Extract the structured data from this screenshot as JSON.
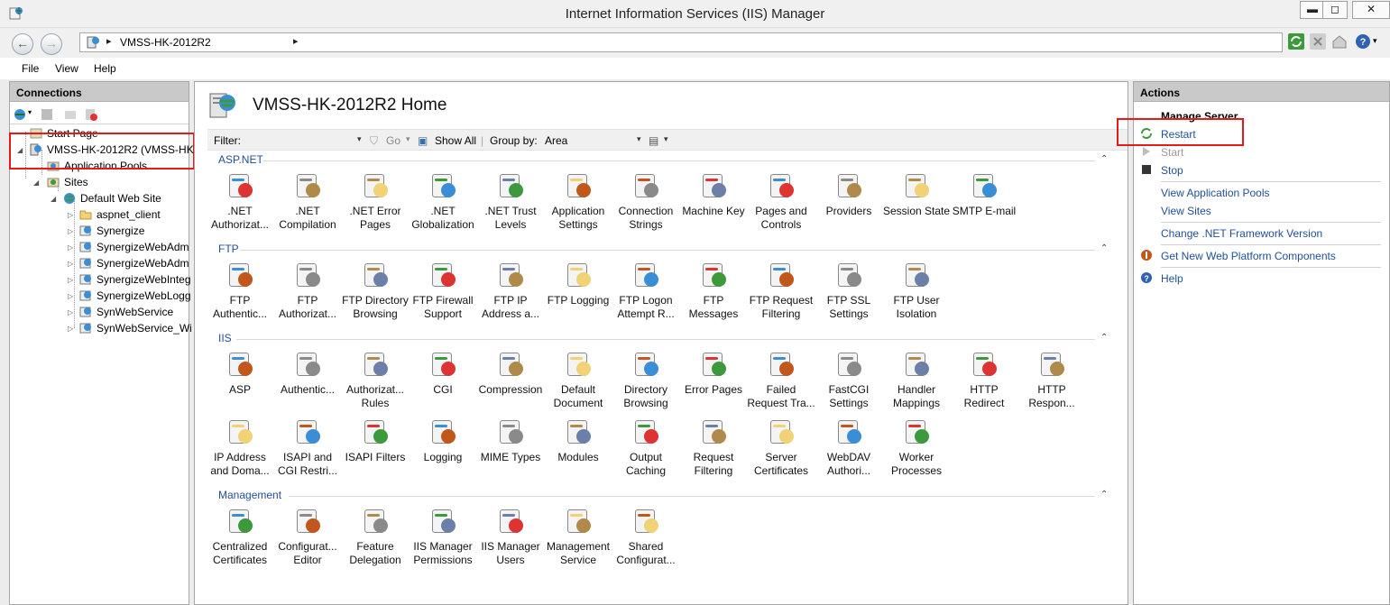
{
  "window": {
    "title": "Internet Information Services (IIS) Manager",
    "min": "▬",
    "max": "◻",
    "close": "✕"
  },
  "address": {
    "host": "VMSS-HK-2012R2",
    "sep": "▸"
  },
  "menu": [
    "File",
    "View",
    "Help"
  ],
  "connections": {
    "title": "Connections",
    "tree": [
      {
        "label": "Start Page"
      },
      {
        "label": "VMSS-HK-2012R2 (VMSS-HK-"
      },
      {
        "label": "Application Pools"
      },
      {
        "label": "Sites"
      },
      {
        "label": "Default Web Site"
      },
      {
        "label": "aspnet_client"
      },
      {
        "label": "Synergize"
      },
      {
        "label": "SynergizeWebAdm"
      },
      {
        "label": "SynergizeWebAdm"
      },
      {
        "label": "SynergizeWebInteg"
      },
      {
        "label": "SynergizeWebLogg"
      },
      {
        "label": "SynWebService"
      },
      {
        "label": "SynWebService_Wi"
      }
    ]
  },
  "home": {
    "title": "VMSS-HK-2012R2 Home"
  },
  "filterbar": {
    "filter_label": "Filter:",
    "go": "Go",
    "show_all": "Show All",
    "group_by": "Group by:",
    "group_value": "Area"
  },
  "sections": {
    "aspnet": {
      "title": "ASP.NET",
      "items": [
        {
          "l1": ".NET",
          "l2": "Authorizat..."
        },
        {
          "l1": ".NET",
          "l2": "Compilation"
        },
        {
          "l1": ".NET Error",
          "l2": "Pages"
        },
        {
          "l1": ".NET",
          "l2": "Globalization"
        },
        {
          "l1": ".NET Trust",
          "l2": "Levels"
        },
        {
          "l1": "Application",
          "l2": "Settings"
        },
        {
          "l1": "Connection",
          "l2": "Strings"
        },
        {
          "l1": "Machine Key",
          "l2": ""
        },
        {
          "l1": "Pages and",
          "l2": "Controls"
        },
        {
          "l1": "Providers",
          "l2": ""
        },
        {
          "l1": "Session State",
          "l2": ""
        },
        {
          "l1": "SMTP E-mail",
          "l2": ""
        }
      ]
    },
    "ftp": {
      "title": "FTP",
      "items": [
        {
          "l1": "FTP",
          "l2": "Authentic..."
        },
        {
          "l1": "FTP",
          "l2": "Authorizat..."
        },
        {
          "l1": "FTP Directory",
          "l2": "Browsing"
        },
        {
          "l1": "FTP Firewall",
          "l2": "Support"
        },
        {
          "l1": "FTP IP",
          "l2": "Address a..."
        },
        {
          "l1": "FTP Logging",
          "l2": ""
        },
        {
          "l1": "FTP Logon",
          "l2": "Attempt R..."
        },
        {
          "l1": "FTP",
          "l2": "Messages"
        },
        {
          "l1": "FTP Request",
          "l2": "Filtering"
        },
        {
          "l1": "FTP SSL",
          "l2": "Settings"
        },
        {
          "l1": "FTP User",
          "l2": "Isolation"
        }
      ]
    },
    "iis": {
      "title": "IIS",
      "items": [
        {
          "l1": "ASP",
          "l2": ""
        },
        {
          "l1": "Authentic...",
          "l2": ""
        },
        {
          "l1": "Authorizat...",
          "l2": "Rules"
        },
        {
          "l1": "CGI",
          "l2": ""
        },
        {
          "l1": "Compression",
          "l2": ""
        },
        {
          "l1": "Default",
          "l2": "Document"
        },
        {
          "l1": "Directory",
          "l2": "Browsing"
        },
        {
          "l1": "Error Pages",
          "l2": ""
        },
        {
          "l1": "Failed",
          "l2": "Request Tra..."
        },
        {
          "l1": "FastCGI",
          "l2": "Settings"
        },
        {
          "l1": "Handler",
          "l2": "Mappings"
        },
        {
          "l1": "HTTP",
          "l2": "Redirect"
        },
        {
          "l1": "HTTP",
          "l2": "Respon..."
        },
        {
          "l1": "IP Address",
          "l2": "and Doma..."
        },
        {
          "l1": "ISAPI and",
          "l2": "CGI Restri..."
        },
        {
          "l1": "ISAPI Filters",
          "l2": ""
        },
        {
          "l1": "Logging",
          "l2": ""
        },
        {
          "l1": "MIME Types",
          "l2": ""
        },
        {
          "l1": "Modules",
          "l2": ""
        },
        {
          "l1": "Output",
          "l2": "Caching"
        },
        {
          "l1": "Request",
          "l2": "Filtering"
        },
        {
          "l1": "Server",
          "l2": "Certificates"
        },
        {
          "l1": "WebDAV",
          "l2": "Authori..."
        },
        {
          "l1": "Worker",
          "l2": "Processes"
        }
      ]
    },
    "management": {
      "title": "Management",
      "items": [
        {
          "l1": "Centralized",
          "l2": "Certificates"
        },
        {
          "l1": "Configurat...",
          "l2": "Editor"
        },
        {
          "l1": "Feature",
          "l2": "Delegation"
        },
        {
          "l1": "IIS Manager",
          "l2": "Permissions"
        },
        {
          "l1": "IIS Manager",
          "l2": "Users"
        },
        {
          "l1": "Management",
          "l2": "Service"
        },
        {
          "l1": "Shared",
          "l2": "Configurat..."
        }
      ]
    }
  },
  "actions": {
    "title": "Actions",
    "group": "Manage Server",
    "restart": "Restart",
    "start": "Start",
    "stop": "Stop",
    "view_app_pools": "View Application Pools",
    "view_sites": "View Sites",
    "change_framework": "Change .NET Framework Version",
    "get_components": "Get New Web Platform Components",
    "help": "Help"
  },
  "colors": {
    "link": "#1f4f99",
    "highlight": "#e21b1b",
    "panel_header": "#c9c9c9"
  }
}
